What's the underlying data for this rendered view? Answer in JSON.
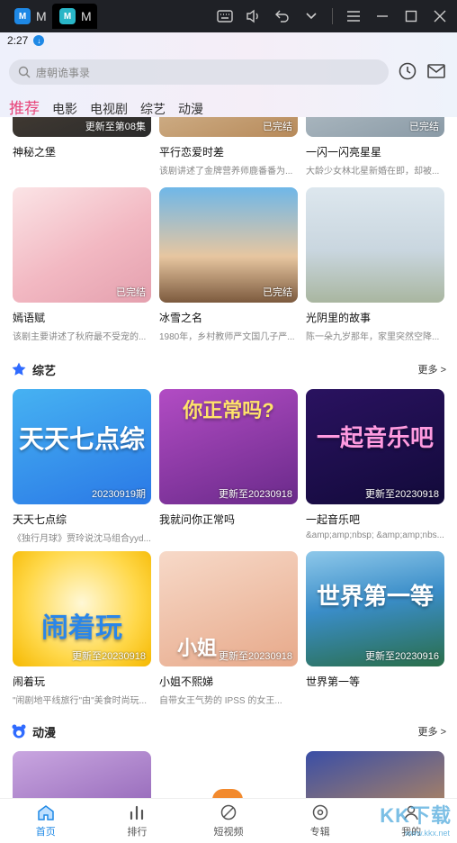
{
  "titlebar": {
    "tab1_icon": "M",
    "tab1_label": "M",
    "tab2_icon": "M",
    "tab2_label": "M"
  },
  "status": {
    "time": "2:27"
  },
  "search": {
    "placeholder": "唐朝诡事录"
  },
  "tabs": [
    "推荐",
    "电影",
    "电视剧",
    "综艺",
    "动漫"
  ],
  "partial_row": [
    {
      "title": "神秘之堡",
      "badge": "更新至第08集"
    },
    {
      "title": "平行恋爱时差",
      "desc": "该剧讲述了金牌营养师鹿番番为...",
      "badge": "已完结"
    },
    {
      "title": "一闪一闪亮星星",
      "desc": "大龄少女林北星新婚在即，却被...",
      "badge": "已完结"
    }
  ],
  "drama_row": [
    {
      "title": "嫣语赋",
      "desc": "该剧主要讲述了秋府最不受宠的...",
      "badge": "已完结"
    },
    {
      "title": "冰雪之名",
      "desc": "1980年，乡村教师严文国几子严...",
      "badge": "已完结"
    },
    {
      "title": "光阴里的故事",
      "desc": "陈一朵九岁那年，家里突然空降...",
      "badge": ""
    }
  ],
  "variety": {
    "title": "综艺",
    "more": "更多 >",
    "row1": [
      {
        "title": "天天七点综",
        "desc": "《独行月球》贾玲说沈马组合yyd...",
        "badge": "20230919期",
        "art": "天天七点综"
      },
      {
        "title": "我就问你正常吗",
        "desc": "",
        "badge": "更新至20230918",
        "art": "你正常吗?"
      },
      {
        "title": "一起音乐吧",
        "desc": "&amp;amp;nbsp; &amp;amp;nbs...",
        "badge": "更新至20230918",
        "art": "一起音乐吧"
      }
    ],
    "row2": [
      {
        "title": "闹着玩",
        "desc": "\"闹剧地平线旅行\"由\"美食时尚玩...",
        "badge": "更新至20230918",
        "art": "闹着玩"
      },
      {
        "title": "小姐不熙娣",
        "desc": "自带女王气势的 IPSS 的女王...",
        "badge": "更新至20230918",
        "art": "小姐"
      },
      {
        "title": "世界第一等",
        "desc": "",
        "badge": "更新至20230916",
        "art": "世界第一等"
      }
    ]
  },
  "anime": {
    "title": "动漫",
    "more": "更多 >"
  },
  "nav": [
    "首页",
    "排行",
    "短视频",
    "专辑",
    "我的"
  ],
  "watermark": {
    "main": "KK下载",
    "sub": "www.kkx.net"
  },
  "colors": {
    "accent": "#e8457a",
    "nav_active": "#1e88e5"
  }
}
